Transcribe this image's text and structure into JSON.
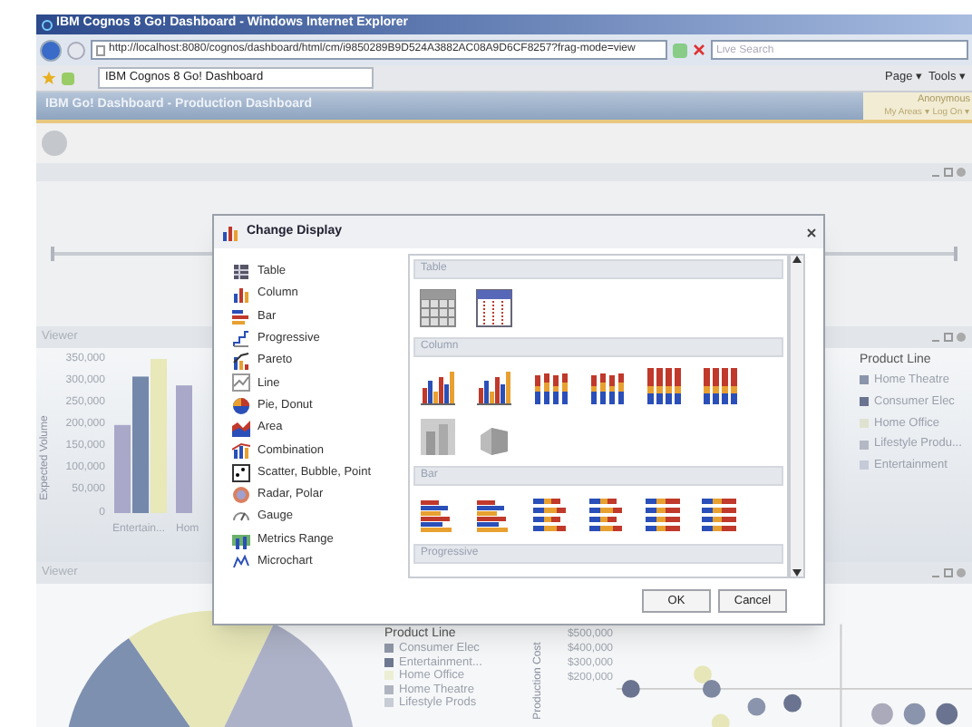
{
  "browser": {
    "title": "IBM Cognos 8 Go! Dashboard - Windows Internet Explorer",
    "address": "http://localhost:8080/cognos/dashboard/html/cm/i9850289B9D524A3882AC08A9D6CF8257?frag-mode=view",
    "search": {
      "placeholder": "Live Search"
    },
    "tab": {
      "label": "IBM Cognos 8 Go! Dashboard"
    },
    "commands": [
      "Page ▾",
      "Tools ▾"
    ]
  },
  "dashboard": {
    "title": "IBM Go! Dashboard - Production Dashboard",
    "user": "Anonymous",
    "links": "My Areas ▾  Log On ▾"
  },
  "viewer_top": {
    "title": "Viewer",
    "chart_data": {
      "type": "bar",
      "ylabel": "Expected Volume",
      "categories": [
        "Entertain...",
        "Hom"
      ],
      "ylim": [
        0,
        350000
      ],
      "yticks": [
        {
          "value": 0,
          "label": "0"
        },
        {
          "value": 50000,
          "label": "50,000"
        },
        {
          "value": 100000,
          "label": "100,000"
        },
        {
          "value": 150000,
          "label": "150,000"
        },
        {
          "value": 200000,
          "label": "200,000"
        },
        {
          "value": 250000,
          "label": "250,000"
        },
        {
          "value": 300000,
          "label": "300,000"
        },
        {
          "value": 350000,
          "label": "350,000"
        }
      ],
      "series": [
        {
          "color": "#a9a8c8",
          "values": [
            200000,
            290000
          ]
        },
        {
          "color": "#7488ab",
          "values": [
            310000,
            null
          ]
        },
        {
          "color": "#e8e8b8",
          "values": [
            350000,
            null
          ]
        }
      ]
    },
    "legend": {
      "title": "Product Line",
      "items": [
        {
          "label": "Home Theatre",
          "color": "#8a94ac"
        },
        {
          "label": "Consumer Elec",
          "color": "#6a7490"
        },
        {
          "label": "Home Office",
          "color": "#e0e2d0"
        },
        {
          "label": "Lifestyle Produ...",
          "color": "#b4b8c4"
        },
        {
          "label": "Entertainment",
          "color": "#c4cad8"
        }
      ]
    }
  },
  "viewer_bottom": {
    "title": "Viewer",
    "legend": {
      "title": "Product Line",
      "items": [
        {
          "label": "Consumer Elec",
          "color": "#9098a8"
        },
        {
          "label": "Entertainment...",
          "color": "#6e7890"
        },
        {
          "label": "Home Office",
          "color": "#ecefd4"
        },
        {
          "label": "Home Theatre",
          "color": "#b0b4c0"
        },
        {
          "label": "Lifestyle Prods",
          "color": "#c8ccd4"
        }
      ]
    },
    "ylabel": "Production Cost",
    "yticks": [
      "$500,000",
      "$400,000",
      "$300,000",
      "$200,000"
    ]
  },
  "dialog": {
    "title": "Change Display",
    "types": [
      {
        "label": "Table",
        "kind": "table"
      },
      {
        "label": "Column",
        "kind": "column"
      },
      {
        "label": "Bar",
        "kind": "bar"
      },
      {
        "label": "Progressive",
        "kind": "progressive"
      },
      {
        "label": "Pareto",
        "kind": "pareto"
      },
      {
        "label": "Line",
        "kind": "line"
      },
      {
        "label": "Pie, Donut",
        "kind": "pie"
      },
      {
        "label": "Area",
        "kind": "area"
      },
      {
        "label": "Combination",
        "kind": "combination"
      },
      {
        "label": "Scatter, Bubble, Point",
        "kind": "scatter"
      },
      {
        "label": "Radar, Polar",
        "kind": "radar"
      },
      {
        "label": "Gauge",
        "kind": "gauge"
      },
      {
        "label": "Metrics Range",
        "kind": "metrics"
      },
      {
        "label": "Microchart",
        "kind": "microchart"
      }
    ],
    "sections": [
      {
        "title": "Table",
        "items": [
          {
            "kind": "grid"
          },
          {
            "kind": "colored-grid"
          }
        ]
      },
      {
        "title": "Column",
        "items": [
          {
            "kind": "column"
          },
          {
            "kind": "column"
          },
          {
            "kind": "stacked-column"
          },
          {
            "kind": "stacked-column"
          },
          {
            "kind": "full-column"
          },
          {
            "kind": "full-column"
          },
          {
            "kind": "gray-column"
          },
          {
            "kind": "gray-3d"
          }
        ]
      },
      {
        "title": "Bar",
        "items": [
          {
            "kind": "bar"
          },
          {
            "kind": "bar"
          },
          {
            "kind": "stacked-bar"
          },
          {
            "kind": "stacked-bar"
          },
          {
            "kind": "full-bar"
          },
          {
            "kind": "full-bar"
          }
        ]
      },
      {
        "title": "Progressive"
      }
    ],
    "buttons": [
      "OK",
      "Cancel"
    ]
  }
}
